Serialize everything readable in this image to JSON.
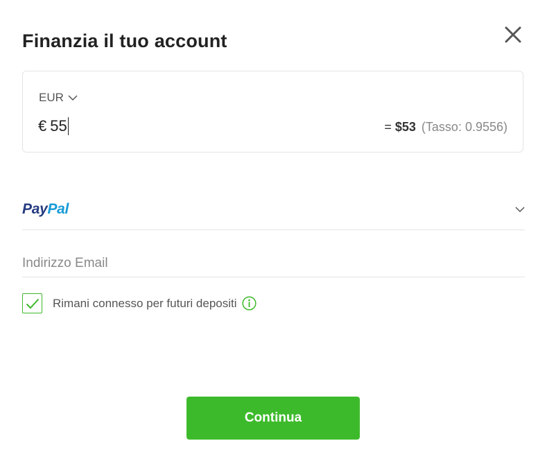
{
  "dialog": {
    "title": "Finanzia il tuo account"
  },
  "amount_card": {
    "currency": "EUR",
    "currency_symbol": "€",
    "amount": "55",
    "converted_prefix": "=",
    "converted_value": "$53",
    "rate_text": "(Tasso: 0.9556)"
  },
  "payment_method": {
    "logo_pay": "Pay",
    "logo_pal": "Pal"
  },
  "email": {
    "placeholder": "Indirizzo Email",
    "value": ""
  },
  "remember": {
    "label": "Rimani connesso per futuri depositi",
    "checked": true
  },
  "actions": {
    "continue_label": "Continua"
  },
  "colors": {
    "accent": "#3dba2b",
    "paypal_dark": "#253b80",
    "paypal_light": "#179bd7"
  }
}
